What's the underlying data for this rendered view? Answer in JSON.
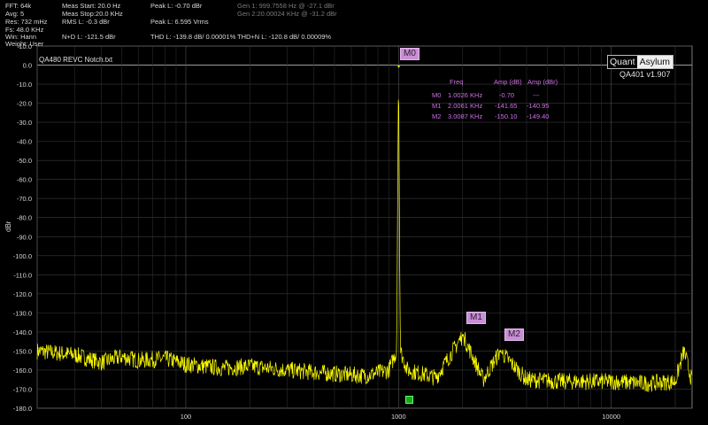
{
  "stats": {
    "fft": "FFT: 64k",
    "avg": "Avg: 5",
    "res": "Res: 732 mHz",
    "fs": "Fs: 48.0 KHz",
    "win": "Win: Hann",
    "weight": "Weight: User",
    "meas_start": "Meas Start: 20.0 Hz",
    "meas_stop": "Meas Stop:20.0 KHz",
    "rms_l": "RMS L: -0.3 dBr",
    "nd_l": "N+D L: -121.5 dBr",
    "peak_l_dbr": "Peak L: -0.70 dBr",
    "peak_l_vrms": "Peak L: 6.595 Vrms",
    "thd_l": "THD L: -139.8 dB/ 0.00001%",
    "thdn_l": "THD+N L: -120.8 dB/ 0.00009%",
    "gen1": "Gen 1: 999.7558 Hz @ -27.1  dBr",
    "gen2": "Gen 2:20.00024 KHz @ -31.2  dBr"
  },
  "plot": {
    "file_title": "QA480 REVC Notch.txt",
    "brand_quant": "Quant",
    "brand_asylum": "Asylum",
    "version": "QA401 v1.907",
    "ylabel": "dBr"
  },
  "marker_table": {
    "headers": [
      "Freq",
      "Amp (dB)",
      "Amp (dBr)"
    ],
    "rows": [
      {
        "name": "M0",
        "freq": "1.0026 KHz",
        "amp_db": "-0.70",
        "amp_dbr": "---"
      },
      {
        "name": "M1",
        "freq": "2.0061 KHz",
        "amp_db": "-141.65",
        "amp_dbr": "-140.95"
      },
      {
        "name": "M2",
        "freq": "3.0087 KHz",
        "amp_db": "-150.10",
        "amp_dbr": "-149.40"
      }
    ]
  },
  "markers": [
    "M0",
    "M1",
    "M2"
  ],
  "chart_data": {
    "type": "line",
    "ylabel": "dBr",
    "ylim": [
      -180,
      10
    ],
    "xscale": "log",
    "xlim": [
      20,
      24000
    ],
    "x_tick_labels": [
      "100",
      "1000",
      "10000"
    ],
    "y_tick_labels": [
      "10.0",
      "0.0",
      "-10.0",
      "-20.0",
      "-30.0",
      "-40.0",
      "-50.0",
      "-60.0",
      "-70.0",
      "-80.0",
      "-90.0",
      "-100.0",
      "-110.0",
      "-120.0",
      "-130.0",
      "-140.0",
      "-150.0",
      "-160.0",
      "-170.0",
      "-180.0"
    ],
    "grid": true,
    "series_color": "#ffff00",
    "series": [
      {
        "x": [
          20,
          30,
          40,
          50,
          60,
          80,
          100,
          150,
          200,
          300,
          500,
          700,
          900,
          980,
          1000,
          1020,
          1100,
          1500,
          2006,
          2500,
          3009,
          4000,
          6000,
          10000,
          15000,
          20000,
          22000,
          24000
        ],
        "y": [
          -150,
          -152,
          -156,
          -153,
          -155,
          -154,
          -157,
          -159,
          -158,
          -160,
          -162,
          -163,
          -160,
          -150,
          -0.7,
          -150,
          -160,
          -164,
          -141.7,
          -165,
          -150.1,
          -165,
          -166,
          -166,
          -167,
          -166,
          -150,
          -166
        ]
      }
    ],
    "marker_points": [
      {
        "name": "M0",
        "x": 1002.6,
        "y": -0.7
      },
      {
        "name": "M1",
        "x": 2006.1,
        "y": -141.65
      },
      {
        "name": "M2",
        "x": 3008.7,
        "y": -150.1
      }
    ]
  }
}
